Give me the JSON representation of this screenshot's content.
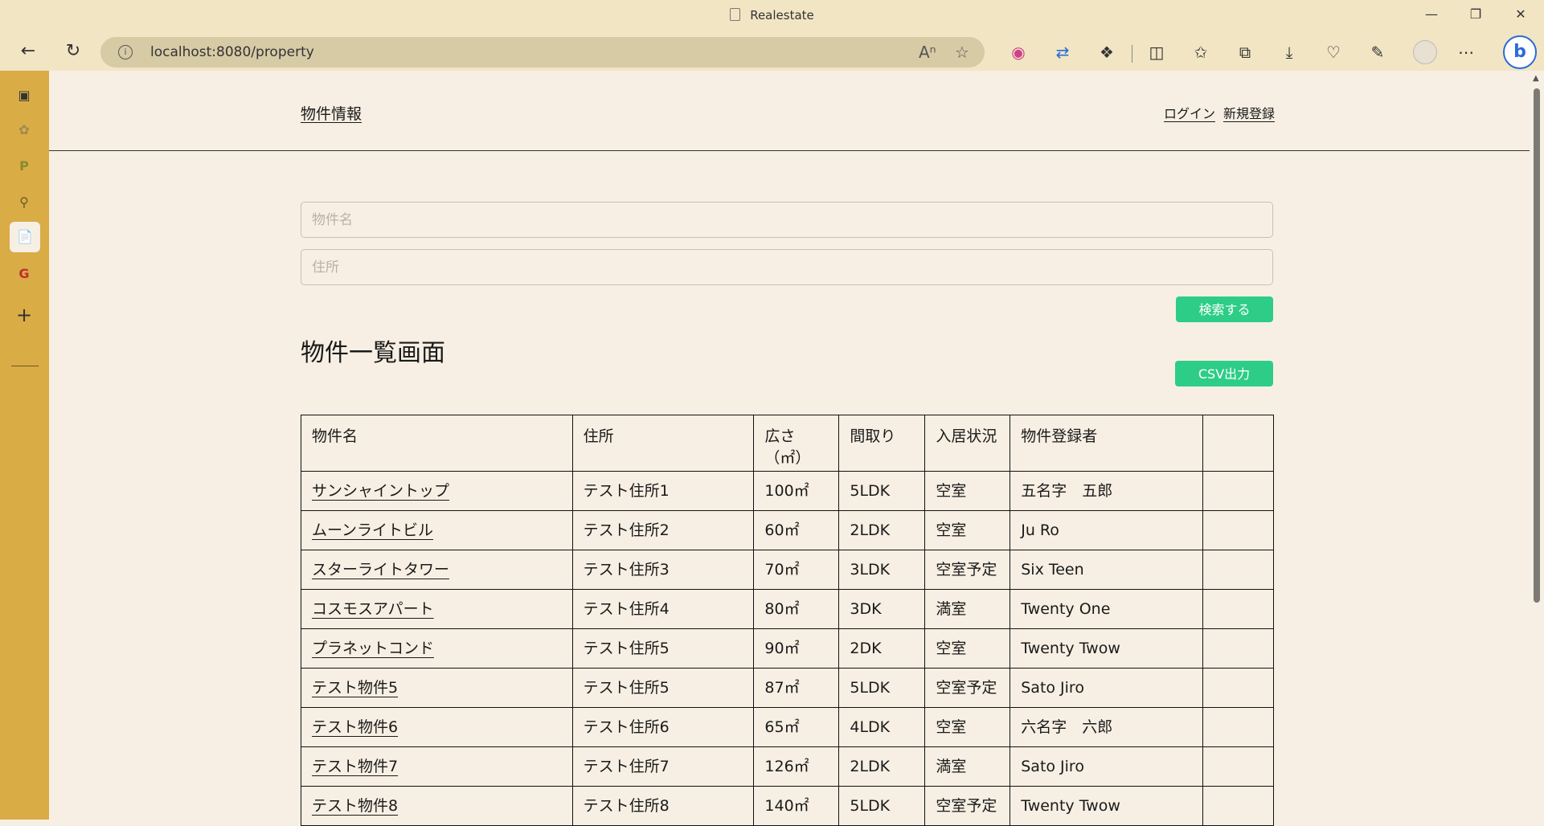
{
  "browser": {
    "tab_title": "Realestate",
    "url": "localhost:8080/property",
    "window_controls": [
      "minimize-icon",
      "restore-icon",
      "close-icon"
    ],
    "nav_icons": [
      "back-arrow-icon",
      "refresh-icon"
    ],
    "address_icons": [
      "info-icon",
      "read-aloud-icon",
      "favorite-star-icon"
    ],
    "toolbar_icons": [
      "color-extension-icon",
      "translate-icon",
      "extensions-icon",
      "split-screen-icon",
      "favorites-icon",
      "collections-icon",
      "downloads-icon",
      "performance-icon",
      "browser-essentials-icon",
      "profile-icon",
      "more-icon",
      "bing-copilot-icon"
    ]
  },
  "sidebar": {
    "icons": [
      "tab-actions-icon",
      "chatgpt-icon",
      "extension-p-icon",
      "search-icon",
      "document-icon",
      "google-icon",
      "add-icon"
    ]
  },
  "header": {
    "brand": "物件情報",
    "login": "ログイン",
    "register": "新規登録"
  },
  "search": {
    "name_placeholder": "物件名",
    "address_placeholder": "住所",
    "name_value": "",
    "address_value": "",
    "submit_label": "検索する"
  },
  "main": {
    "heading": "物件一覧画面",
    "csv_label": "CSV出力"
  },
  "table": {
    "headers": {
      "name": "物件名",
      "address": "住所",
      "area": "広さ（㎡）",
      "layout": "間取り",
      "status": "入居状況",
      "registrant": "物件登録者",
      "actions": ""
    },
    "rows": [
      {
        "name": "サンシャイントップ",
        "address": "テスト住所1",
        "area": "100㎡",
        "layout": "5LDK",
        "status": "空室",
        "registrant": "五名字　五郎"
      },
      {
        "name": "ムーンライトビル",
        "address": "テスト住所2",
        "area": "60㎡",
        "layout": "2LDK",
        "status": "空室",
        "registrant": "Ju Ro"
      },
      {
        "name": "スターライトタワー",
        "address": "テスト住所3",
        "area": "70㎡",
        "layout": "3LDK",
        "status": "空室予定",
        "registrant": "Six Teen"
      },
      {
        "name": "コスモスアパート",
        "address": "テスト住所4",
        "area": "80㎡",
        "layout": "3DK",
        "status": "満室",
        "registrant": "Twenty One"
      },
      {
        "name": "プラネットコンド",
        "address": "テスト住所5",
        "area": "90㎡",
        "layout": "2DK",
        "status": "空室",
        "registrant": "Twenty Twow"
      },
      {
        "name": "テスト物件5",
        "address": "テスト住所5",
        "area": "87㎡",
        "layout": "5LDK",
        "status": "空室予定",
        "registrant": "Sato Jiro"
      },
      {
        "name": "テスト物件6",
        "address": "テスト住所6",
        "area": "65㎡",
        "layout": "4LDK",
        "status": "空室",
        "registrant": "六名字　六郎"
      },
      {
        "name": "テスト物件7",
        "address": "テスト住所7",
        "area": "126㎡",
        "layout": "2LDK",
        "status": "満室",
        "registrant": "Sato Jiro"
      },
      {
        "name": "テスト物件8",
        "address": "テスト住所8",
        "area": "140㎡",
        "layout": "5LDK",
        "status": "空室予定",
        "registrant": "Twenty Twow"
      }
    ]
  },
  "colors": {
    "page_bg": "#f7efe3",
    "chrome_bg": "#f1e5c4",
    "sidebar_bg": "#d9ac45",
    "accent_green": "#2dcd87"
  }
}
